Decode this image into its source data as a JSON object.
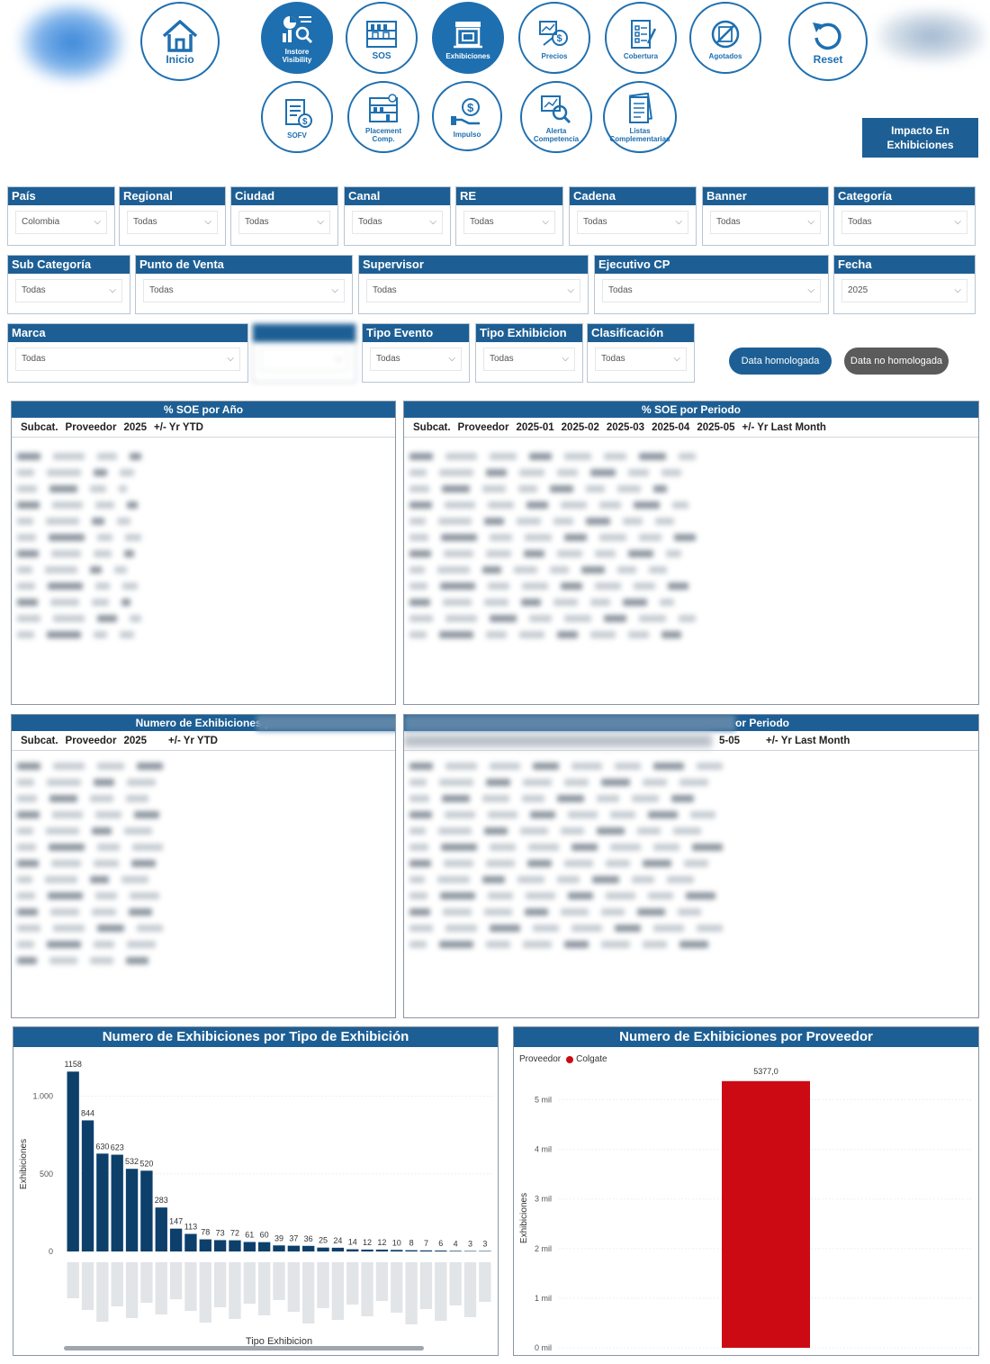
{
  "nav": {
    "inicio": "Inicio",
    "instore_1": "Instore",
    "instore_2": "Visibility",
    "sos": "SOS",
    "exhibiciones": "Exhibiciones",
    "precios": "Precios",
    "cobertura": "Cobertura",
    "agotados": "Agotados",
    "reset": "Reset",
    "sofv": "SOFV",
    "placement_1": "Placement",
    "placement_2": "Comp.",
    "impulso": "Impulso",
    "alerta_1": "Alerta",
    "alerta_2": "Competencia",
    "listas_1": "Listas",
    "listas_2": "Complementarias",
    "impacto": "Impacto En Exhibiciones"
  },
  "filters": {
    "pais": {
      "label": "País",
      "value": "Colombia"
    },
    "regional": {
      "label": "Regional",
      "value": "Todas"
    },
    "ciudad": {
      "label": "Ciudad",
      "value": "Todas"
    },
    "canal": {
      "label": "Canal",
      "value": "Todas"
    },
    "re": {
      "label": "RE",
      "value": "Todas"
    },
    "cadena": {
      "label": "Cadena",
      "value": "Todas"
    },
    "banner": {
      "label": "Banner",
      "value": "Todas"
    },
    "categoria": {
      "label": "Categoría",
      "value": "Todas"
    },
    "subcategoria": {
      "label": "Sub Categoría",
      "value": "Todas"
    },
    "punto_venta": {
      "label": "Punto de Venta",
      "value": "Todas"
    },
    "supervisor": {
      "label": "Supervisor",
      "value": "Todas"
    },
    "ejecutivo": {
      "label": "Ejecutivo CP",
      "value": "Todas"
    },
    "fecha": {
      "label": "Fecha",
      "value": "2025"
    },
    "marca": {
      "label": "Marca",
      "value": "Todas"
    },
    "tipo_evento": {
      "label": "Tipo Evento",
      "value": "Todas"
    },
    "tipo_exhibicion": {
      "label": "Tipo Exhibicion",
      "value": "Todas"
    },
    "clasificacion": {
      "label": "Clasificación",
      "value": "Todas"
    }
  },
  "toggles": {
    "homologada": "Data homologada",
    "no_homologada": "Data no homologada",
    "homologada_color": "#1d5f94",
    "no_homologada_color": "#5b5b5b"
  },
  "tables": {
    "soe_anio": {
      "title": "% SOE por Año",
      "columns": [
        "Subcat.",
        "Proveedor",
        "2025",
        "+/- Yr YTD"
      ]
    },
    "soe_periodo": {
      "title": "% SOE por Periodo",
      "columns": [
        "Subcat.",
        "Proveedor",
        "2025-01",
        "2025-02",
        "2025-03",
        "2025-04",
        "2025-05",
        "+/- Yr Last Month"
      ]
    },
    "num_anio": {
      "title": "Numero de Exhibiciones p",
      "columns": [
        "Subcat.",
        "Proveedor",
        "2025",
        "+/- Yr YTD"
      ]
    },
    "num_periodo": {
      "title": "or Periodo",
      "columns": [
        "5-05",
        "+/- Yr Last Month"
      ]
    }
  },
  "chart_data": [
    {
      "type": "bar",
      "title": "Numero de Exhibiciones por Tipo de Exhibición",
      "xlabel": "Tipo Exhibicion",
      "ylabel": "Exhibiciones",
      "yticks": [
        "0",
        "500",
        "1.000"
      ],
      "ylim": [
        0,
        1200
      ],
      "values": [
        1158,
        844,
        630,
        623,
        532,
        520,
        283,
        147,
        113,
        78,
        73,
        72,
        61,
        60,
        39,
        37,
        36,
        25,
        24,
        14,
        12,
        12,
        10,
        8,
        7,
        6,
        4,
        3,
        3
      ],
      "color": "#0d3f6b"
    },
    {
      "type": "bar",
      "title": "Numero de Exhibiciones por Proveedor",
      "legend_title": "Proveedor",
      "series": [
        {
          "name": "Colgate",
          "values": [
            5377.0
          ],
          "label": "5377,0"
        }
      ],
      "ylabel": "Exhibiciones",
      "yticks": [
        "0 mil",
        "1 mil",
        "2 mil",
        "3 mil",
        "4 mil",
        "5 mil"
      ],
      "ylim": [
        0,
        5700
      ],
      "color": "#cc0a14"
    }
  ]
}
